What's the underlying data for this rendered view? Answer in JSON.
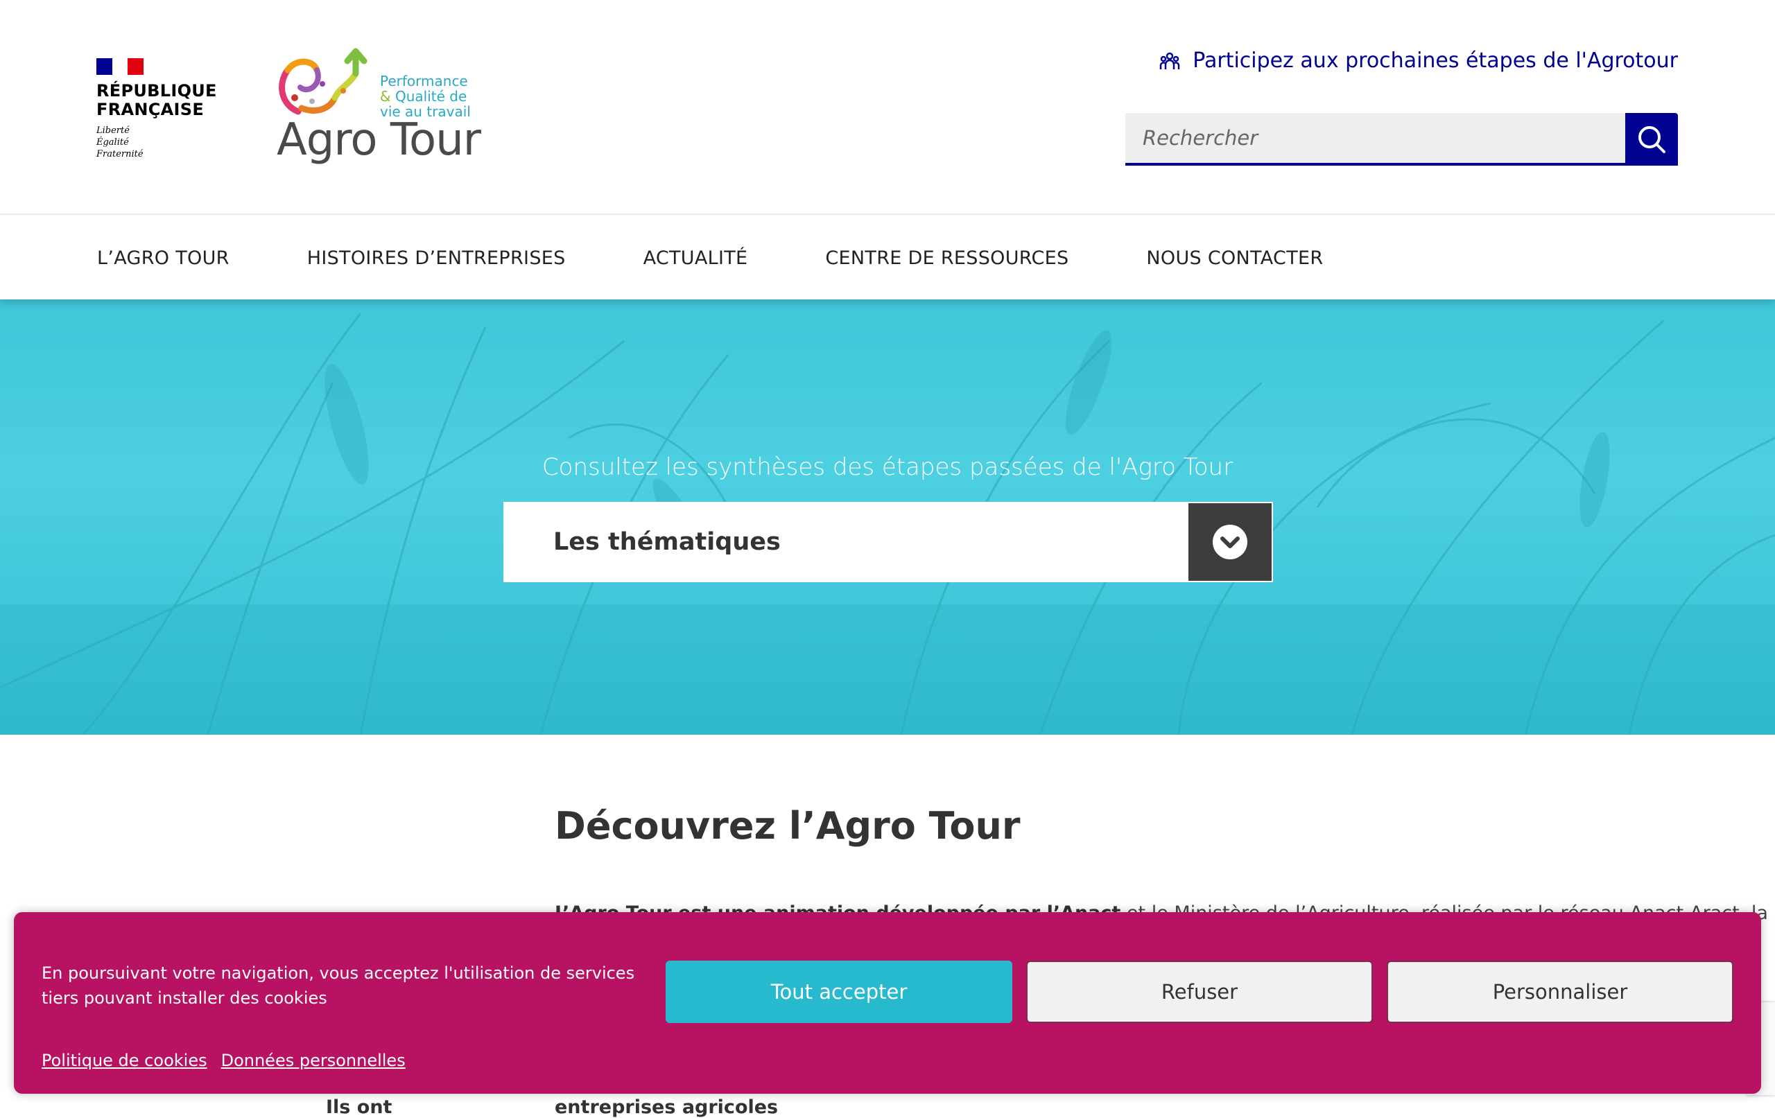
{
  "header": {
    "republique": {
      "name_line1": "RÉPUBLIQUE",
      "name_line2": "FRANÇAISE",
      "motto_line1": "Liberté",
      "motto_line2": "Égalité",
      "motto_line3": "Fraternité"
    },
    "logo": {
      "tagline_line1": "Performance",
      "tagline_amp": "&",
      "tagline_line2": "Qualité de",
      "tagline_line3": "vie au travail",
      "title": "Agro Tour"
    },
    "participate_link": "Participez aux prochaines étapes de l'Agrotour",
    "participate_icon": "people-icon",
    "search": {
      "placeholder": "Rechercher",
      "icon": "search-icon"
    }
  },
  "nav": {
    "items": [
      {
        "label": "L’AGRO TOUR"
      },
      {
        "label": "HISTOIRES D’ENTREPRISES"
      },
      {
        "label": "ACTUALITÉ"
      },
      {
        "label": "CENTRE DE RESSOURCES"
      },
      {
        "label": "NOUS CONTACTER"
      }
    ]
  },
  "hero": {
    "caption": "Consultez les synthèses des étapes passées de l'Agro Tour",
    "select_label": "Les thématiques",
    "select_icon": "chevron-down-icon"
  },
  "content": {
    "title": "Découvrez l’Agro Tour",
    "peek_bold": "L’Agro Tour est une animation développée par l’Anact",
    "peek_rest": " et le Ministère de l’Agriculture, réalisée par le réseau Anact-Aract, la",
    "peek_bottom": "entreprises agricoles",
    "side_peek": "Ils ont"
  },
  "cookie_banner": {
    "text": "En poursuivant votre navigation, vous acceptez l'utilisation de services tiers pouvant installer des cookies",
    "accept_label": "Tout accepter",
    "refuse_label": "Refuser",
    "customize_label": "Personnaliser",
    "policy_link": "Politique de cookies",
    "data_link": "Données personnelles"
  },
  "colors": {
    "brand_blue": "#000091",
    "hero_cyan": "#4dd0e1",
    "cookie_bg": "#b81262",
    "accept_btn": "#27b9cd"
  }
}
